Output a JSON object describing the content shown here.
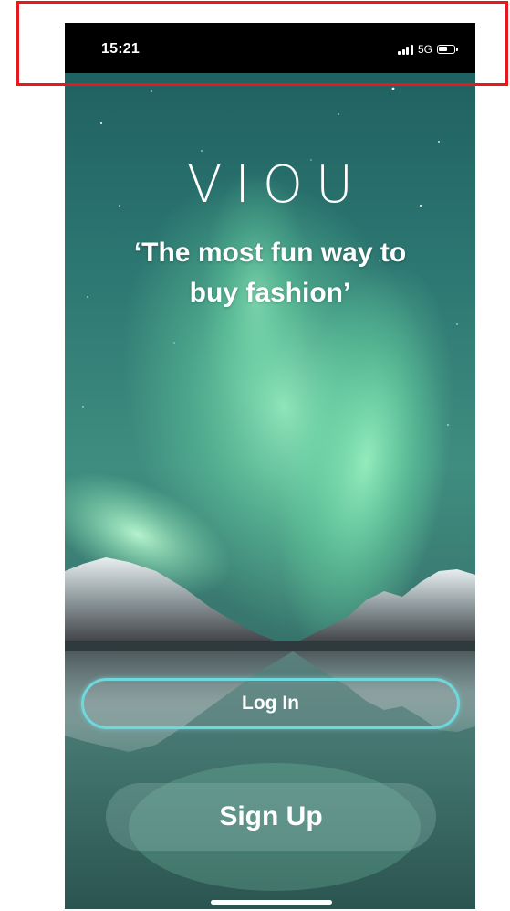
{
  "status_bar": {
    "time": "15:21",
    "network": "5G",
    "icons": [
      "signal-bars-icon",
      "battery-icon"
    ]
  },
  "app": {
    "logo": "VIOU",
    "tagline_line1": "‘The most fun way to",
    "tagline_line2": "buy fashion’"
  },
  "actions": {
    "login_label": "Log In",
    "signup_label": "Sign Up"
  },
  "colors": {
    "annotation": "#e8191c",
    "login_border": "#6fd8dd",
    "aurora": "#7ef0b6",
    "sky_top": "#1d5c5c"
  }
}
